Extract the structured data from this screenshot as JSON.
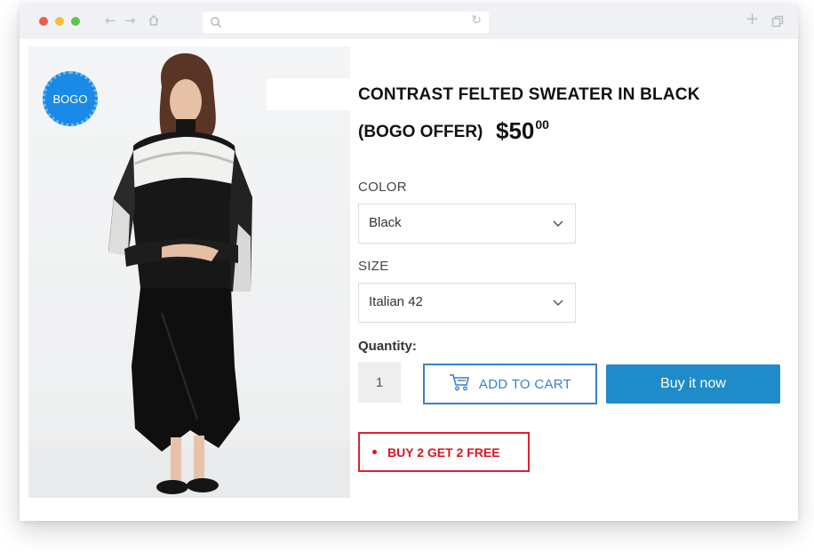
{
  "browser": {
    "url": "",
    "icons": [
      "back-icon",
      "forward-icon",
      "home-icon",
      "search-icon",
      "reload-icon",
      "new-tab-icon",
      "tabs-icon"
    ]
  },
  "product": {
    "badge": "BOGO",
    "title_line1": "CONTRAST FELTED SWEATER IN BLACK",
    "title_line2": "(BOGO OFFER)",
    "price_main": "$50",
    "price_cents": "00",
    "color_label": "COLOR",
    "color_value": "Black",
    "size_label": "SIZE",
    "size_value": "Italian 42",
    "quantity_label": "Quantity:",
    "quantity_value": "1",
    "add_to_cart": "ADD TO CART",
    "buy_now": "Buy it now",
    "offer": "BUY 2 GET 2 FREE"
  },
  "colors": {
    "badge": "#1a8ae6",
    "add_to_cart": "#3a80c4",
    "buy_now": "#1f8cc9",
    "offer": "#e0202a"
  }
}
